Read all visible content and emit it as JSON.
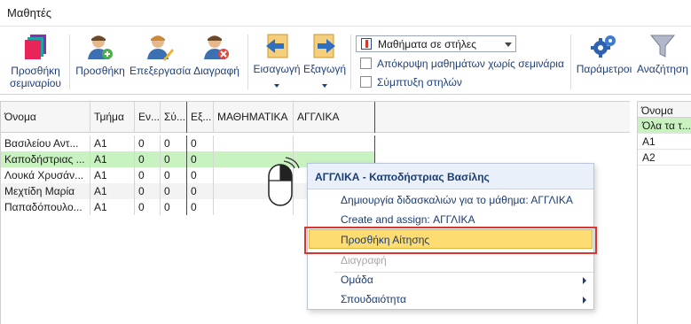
{
  "window": {
    "title": "Μαθητές"
  },
  "toolbar": {
    "add_seminar_line1": "Προσθήκη",
    "add_seminar_line2": "σεμιναρίου",
    "add": "Προσθήκη",
    "edit": "Επεξεργασία",
    "delete": "Διαγραφή",
    "import": "Εισαγωγή",
    "export": "Εξαγωγή",
    "view_mode": "Μαθήματα σε στήλες",
    "hide_courses_label": "Απόκρυψη μαθημάτων χωρίς σεμινάρια",
    "collapse_columns_label": "Σύμπτυξη στηλών",
    "parameters": "Παράμετροι",
    "search": "Αναζήτηση"
  },
  "grid": {
    "columns": [
      "Όνομα",
      "Τμήμα",
      "Εν...",
      "Σύ...",
      "Εξ...",
      "ΜΑΘΗΜΑΤΙΚΑ",
      "ΑΓΓΛΙΚΑ"
    ],
    "rows": [
      [
        "Βασιλείου Αντ...",
        "Α1",
        "0",
        "0",
        "0",
        "",
        ""
      ],
      [
        "Καποδήστριας ...",
        "Α1",
        "0",
        "0",
        "0",
        "",
        ""
      ],
      [
        "Λουκά Χρυσάν...",
        "Α1",
        "0",
        "0",
        "0",
        "",
        ""
      ],
      [
        "Μεχτίδη Μαρία",
        "Α1",
        "0",
        "0",
        "0",
        "",
        ""
      ],
      [
        "Παπαδόπουλο...",
        "Α1",
        "0",
        "0",
        "0",
        "",
        ""
      ]
    ]
  },
  "side_panel": {
    "header": "Όνομα",
    "items": [
      "Όλα τα τ...",
      "Α1",
      "Α2"
    ]
  },
  "context_menu": {
    "title": "ΑΓΓΛΙΚΑ - Καποδήστριας Βασίλης",
    "items": [
      "Δημιουργία διδασκαλιών για το μάθημα: ΑΓΓΛΙΚΑ",
      "Create and assign:  ΑΓΓΛΙΚΑ",
      "Προσθήκη Αίτησης",
      "Διαγραφή",
      "Ομάδα",
      "Σπουδαιότητα"
    ]
  },
  "colors": {
    "selected_row": "#c8f2c0",
    "menu_highlight": "#fddc72",
    "callout_red": "#d9362f",
    "link_blue": "#1f3f7a"
  }
}
